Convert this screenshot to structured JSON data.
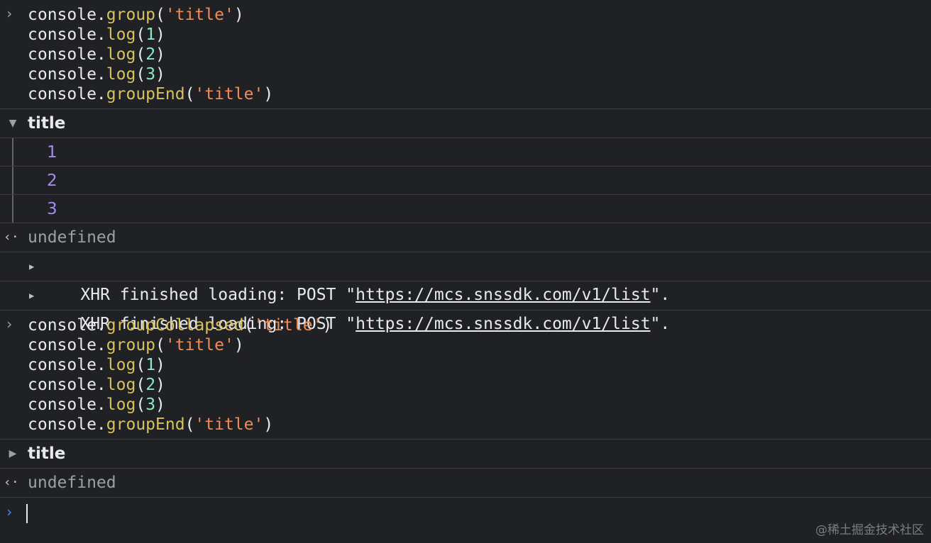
{
  "console": {
    "block1": {
      "prompt": "›",
      "lines": [
        [
          "console.",
          "group",
          "(",
          "'title'",
          ")"
        ],
        [
          "console.",
          "log",
          "(",
          "1",
          ")"
        ],
        [
          "console.",
          "log",
          "(",
          "2",
          ")"
        ],
        [
          "console.",
          "log",
          "(",
          "3",
          ")"
        ],
        [
          "console.",
          "groupEnd",
          "(",
          "'title'",
          ")"
        ]
      ]
    },
    "group1": {
      "label": "title",
      "toggle_icon": "▼",
      "children": [
        "1",
        "2",
        "3"
      ]
    },
    "result1": {
      "arrow": "‹·",
      "value": "undefined"
    },
    "xhr": [
      {
        "toggle_icon": "▶",
        "prefix": "XHR finished loading: POST \"",
        "url": "https://mcs.snssdk.com/v1/list",
        "suffix": "\"."
      },
      {
        "toggle_icon": "▶",
        "prefix": "XHR finished loading: POST \"",
        "url": "https://mcs.snssdk.com/v1/list",
        "suffix": "\"."
      }
    ],
    "block2": {
      "prompt": "›",
      "lines": [
        [
          "console.",
          "groupCollapsed",
          "(",
          "'title'",
          ")"
        ],
        [
          "console.",
          "group",
          "(",
          "'title'",
          ")"
        ],
        [
          "console.",
          "log",
          "(",
          "1",
          ")"
        ],
        [
          "console.",
          "log",
          "(",
          "2",
          ")"
        ],
        [
          "console.",
          "log",
          "(",
          "3",
          ")"
        ],
        [
          "console.",
          "groupEnd",
          "(",
          "'title'",
          ")"
        ]
      ]
    },
    "group2": {
      "label": "title",
      "toggle_icon": "▶"
    },
    "result2": {
      "arrow": "‹·",
      "value": "undefined"
    },
    "input": {
      "prompt": "›"
    }
  },
  "watermark": "@稀土掘金技术社区",
  "colors": {
    "background": "#202124",
    "method": "#d8c25e",
    "string": "#f28b54",
    "number": "#8be9c6",
    "log_value": "#9f8cf5",
    "prompt_active": "#4a8af4"
  }
}
